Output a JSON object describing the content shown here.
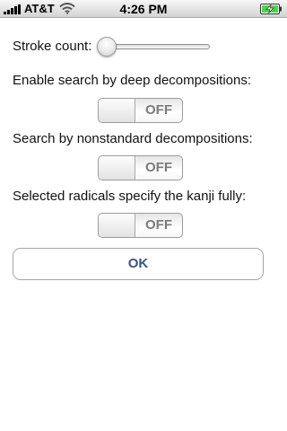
{
  "status_bar": {
    "carrier": "AT&T",
    "time": "4:26 PM",
    "icons": [
      "signal-bars-icon",
      "wifi-icon",
      "battery-charging-icon"
    ],
    "battery_color": "#4cd44c"
  },
  "settings": {
    "stroke_count_label": "Stroke count:",
    "stroke_count_value": 0,
    "deep_decompositions_label": "Enable search by deep decompositions:",
    "deep_decompositions_state": "OFF",
    "nonstandard_decompositions_label": "Search by nonstandard decompositions:",
    "nonstandard_decompositions_state": "OFF",
    "radicals_fully_label": "Selected radicals specify the kanji fully:",
    "radicals_fully_state": "OFF"
  },
  "ok_button_label": "OK",
  "colors": {
    "ok_text": "#385487",
    "toggle_off_text": "#7a7a7a"
  }
}
